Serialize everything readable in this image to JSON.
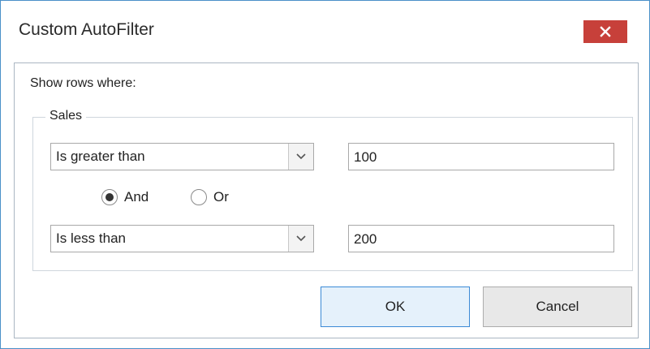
{
  "window": {
    "title": "Custom AutoFilter"
  },
  "dialog": {
    "prompt": "Show rows where:",
    "group_label": "Sales",
    "condition1": {
      "operator": "Is greater than",
      "value": "100"
    },
    "logic": {
      "and_label": "And",
      "or_label": "Or",
      "selected": "And"
    },
    "condition2": {
      "operator": "Is less than",
      "value": "200"
    }
  },
  "buttons": {
    "ok_label": "OK",
    "cancel_label": "Cancel"
  },
  "icons": {
    "close": "close-icon",
    "dropdown": "chevron-down-icon"
  },
  "colors": {
    "close_button_bg": "#c7403a",
    "window_border": "#4a90c8",
    "default_button_border": "#3c8ad6"
  }
}
